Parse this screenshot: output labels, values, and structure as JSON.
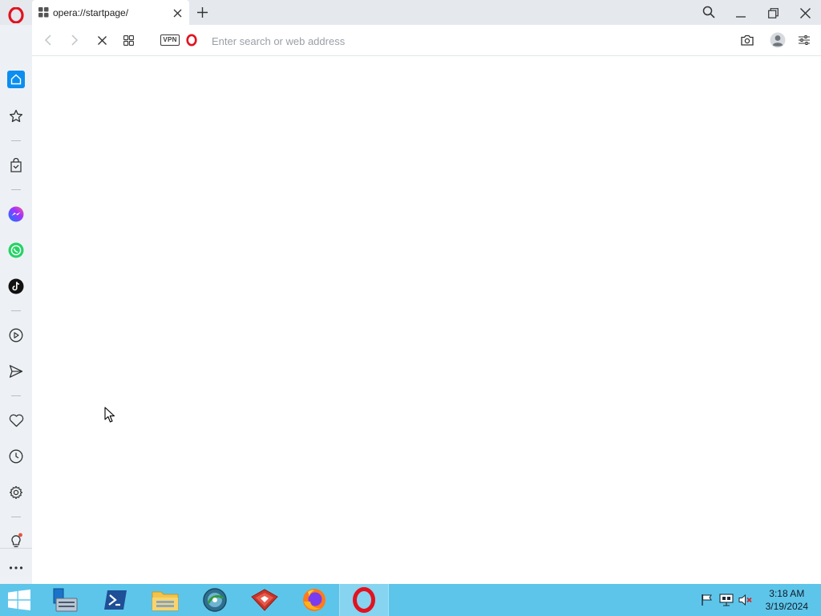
{
  "browser": {
    "tab": {
      "title": "opera://startpage/"
    },
    "address_bar": {
      "placeholder": "Enter search or web address",
      "value": ""
    },
    "vpn_label": "VPN"
  },
  "sidebar": {
    "items": [
      {
        "name": "home",
        "icon": "home-icon",
        "active": true
      },
      {
        "name": "bookmarks",
        "icon": "star-icon"
      },
      {
        "name": "shopping",
        "icon": "shopping-bag-icon"
      },
      {
        "name": "messenger",
        "icon": "messenger-icon"
      },
      {
        "name": "whatsapp",
        "icon": "whatsapp-icon"
      },
      {
        "name": "tiktok",
        "icon": "tiktok-icon"
      },
      {
        "name": "player",
        "icon": "play-icon"
      },
      {
        "name": "send",
        "icon": "send-icon"
      },
      {
        "name": "favorites",
        "icon": "heart-icon"
      },
      {
        "name": "history",
        "icon": "clock-icon"
      },
      {
        "name": "settings",
        "icon": "gear-icon"
      },
      {
        "name": "tips",
        "icon": "lightbulb-icon"
      },
      {
        "name": "more",
        "icon": "more-icon"
      }
    ]
  },
  "taskbar": {
    "apps": [
      "start",
      "server-manager",
      "powershell",
      "file-explorer",
      "network-tool",
      "vpn-client",
      "firefox",
      "opera"
    ],
    "active_app": "opera",
    "clock": {
      "time": "3:18 AM",
      "date": "3/19/2024"
    }
  },
  "colors": {
    "accent": "#0b8ef0",
    "opera_red": "#e3121f",
    "taskbar": "#5ec5ea",
    "sidebar": "#edf1f5",
    "titlebar": "#e5e9ee"
  }
}
